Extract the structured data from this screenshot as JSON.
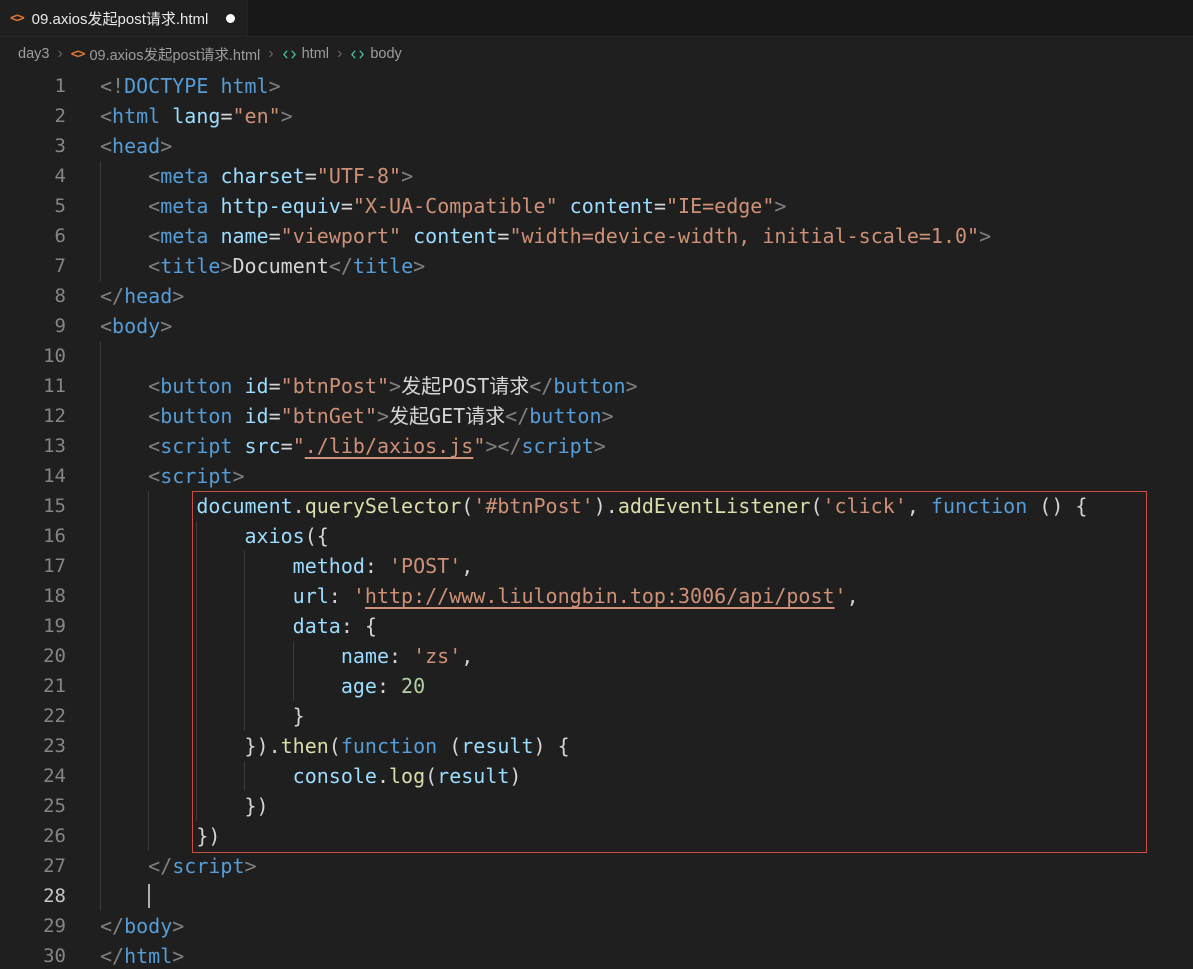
{
  "tab": {
    "title": "09.axios发起post请求.html",
    "modified": true
  },
  "breadcrumb": {
    "items": [
      "day3",
      "09.axios发起post请求.html",
      "html",
      "body"
    ]
  },
  "colors": {
    "annotation_border": "#c94f44",
    "modified_dot": "#ffffff",
    "file_icon": "#e37933",
    "element_icon": "#4ec9b0"
  },
  "editor": {
    "active_line": 28,
    "cursor_col": 4,
    "annotation": {
      "from_line": 15,
      "to_line": 26,
      "color": "#c94f44"
    },
    "lines": [
      {
        "tokens": [
          [
            "pg",
            "<!"
          ],
          [
            "tag",
            "DOCTYPE"
          ],
          [
            "pl",
            " "
          ],
          [
            "tag",
            "html"
          ],
          [
            "pg",
            ">"
          ]
        ]
      },
      {
        "tokens": [
          [
            "pg",
            "<"
          ],
          [
            "tag",
            "html"
          ],
          [
            "pl",
            " "
          ],
          [
            "attr",
            "lang"
          ],
          [
            "pl",
            "="
          ],
          [
            "str",
            "\"en\""
          ],
          [
            "pg",
            ">"
          ]
        ]
      },
      {
        "tokens": [
          [
            "pg",
            "<"
          ],
          [
            "tag",
            "head"
          ],
          [
            "pg",
            ">"
          ]
        ]
      },
      {
        "tokens": [
          [
            "pl",
            "    "
          ],
          [
            "pg",
            "<"
          ],
          [
            "tag",
            "meta"
          ],
          [
            "pl",
            " "
          ],
          [
            "attr",
            "charset"
          ],
          [
            "pl",
            "="
          ],
          [
            "str",
            "\"UTF-8\""
          ],
          [
            "pg",
            ">"
          ]
        ]
      },
      {
        "tokens": [
          [
            "pl",
            "    "
          ],
          [
            "pg",
            "<"
          ],
          [
            "tag",
            "meta"
          ],
          [
            "pl",
            " "
          ],
          [
            "attr",
            "http-equiv"
          ],
          [
            "pl",
            "="
          ],
          [
            "str",
            "\"X-UA-Compatible\""
          ],
          [
            "pl",
            " "
          ],
          [
            "attr",
            "content"
          ],
          [
            "pl",
            "="
          ],
          [
            "str",
            "\"IE=edge\""
          ],
          [
            "pg",
            ">"
          ]
        ]
      },
      {
        "tokens": [
          [
            "pl",
            "    "
          ],
          [
            "pg",
            "<"
          ],
          [
            "tag",
            "meta"
          ],
          [
            "pl",
            " "
          ],
          [
            "attr",
            "name"
          ],
          [
            "pl",
            "="
          ],
          [
            "str",
            "\"viewport\""
          ],
          [
            "pl",
            " "
          ],
          [
            "attr",
            "content"
          ],
          [
            "pl",
            "="
          ],
          [
            "str",
            "\"width=device-width, initial-scale=1.0\""
          ],
          [
            "pg",
            ">"
          ]
        ]
      },
      {
        "tokens": [
          [
            "pl",
            "    "
          ],
          [
            "pg",
            "<"
          ],
          [
            "tag",
            "title"
          ],
          [
            "pg",
            ">"
          ],
          [
            "pl",
            "Document"
          ],
          [
            "pg",
            "</"
          ],
          [
            "tag",
            "title"
          ],
          [
            "pg",
            ">"
          ]
        ]
      },
      {
        "tokens": [
          [
            "pg",
            "</"
          ],
          [
            "tag",
            "head"
          ],
          [
            "pg",
            ">"
          ]
        ]
      },
      {
        "tokens": [
          [
            "pg",
            "<"
          ],
          [
            "tag",
            "body"
          ],
          [
            "pg",
            ">"
          ]
        ]
      },
      {
        "tokens": [],
        "g": 1
      },
      {
        "tokens": [
          [
            "pl",
            "    "
          ],
          [
            "pg",
            "<"
          ],
          [
            "tag",
            "button"
          ],
          [
            "pl",
            " "
          ],
          [
            "attr",
            "id"
          ],
          [
            "pl",
            "="
          ],
          [
            "str",
            "\"btnPost\""
          ],
          [
            "pg",
            ">"
          ],
          [
            "pl",
            "发起POST请求"
          ],
          [
            "pg",
            "</"
          ],
          [
            "tag",
            "button"
          ],
          [
            "pg",
            ">"
          ]
        ]
      },
      {
        "tokens": [
          [
            "pl",
            "    "
          ],
          [
            "pg",
            "<"
          ],
          [
            "tag",
            "button"
          ],
          [
            "pl",
            " "
          ],
          [
            "attr",
            "id"
          ],
          [
            "pl",
            "="
          ],
          [
            "str",
            "\"btnGet\""
          ],
          [
            "pg",
            ">"
          ],
          [
            "pl",
            "发起GET请求"
          ],
          [
            "pg",
            "</"
          ],
          [
            "tag",
            "button"
          ],
          [
            "pg",
            ">"
          ]
        ]
      },
      {
        "tokens": [
          [
            "pl",
            "    "
          ],
          [
            "pg",
            "<"
          ],
          [
            "tag",
            "script"
          ],
          [
            "pl",
            " "
          ],
          [
            "attr",
            "src"
          ],
          [
            "pl",
            "="
          ],
          [
            "str",
            "\""
          ],
          [
            "lnk",
            "./lib/axios.js"
          ],
          [
            "str",
            "\""
          ],
          [
            "pg",
            ">"
          ],
          [
            "pg",
            "</"
          ],
          [
            "tag",
            "script"
          ],
          [
            "pg",
            ">"
          ]
        ]
      },
      {
        "tokens": [
          [
            "pl",
            "    "
          ],
          [
            "pg",
            "<"
          ],
          [
            "tag",
            "script"
          ],
          [
            "pg",
            ">"
          ]
        ]
      },
      {
        "tokens": [
          [
            "pl",
            "        "
          ],
          [
            "var",
            "document"
          ],
          [
            "pl",
            "."
          ],
          [
            "fn",
            "querySelector"
          ],
          [
            "pl",
            "("
          ],
          [
            "str",
            "'#btnPost'"
          ],
          [
            "pl",
            ")."
          ],
          [
            "fn",
            "addEventListener"
          ],
          [
            "pl",
            "("
          ],
          [
            "str",
            "'click'"
          ],
          [
            "pl",
            ", "
          ],
          [
            "kw",
            "function"
          ],
          [
            "pl",
            " () {"
          ]
        ]
      },
      {
        "tokens": [
          [
            "pl",
            "            "
          ],
          [
            "var",
            "axios"
          ],
          [
            "pl",
            "({"
          ]
        ]
      },
      {
        "tokens": [
          [
            "pl",
            "                "
          ],
          [
            "var",
            "method"
          ],
          [
            "pl",
            ": "
          ],
          [
            "str",
            "'POST'"
          ],
          [
            "pl",
            ","
          ]
        ]
      },
      {
        "tokens": [
          [
            "pl",
            "                "
          ],
          [
            "var",
            "url"
          ],
          [
            "pl",
            ": "
          ],
          [
            "str",
            "'"
          ],
          [
            "lnk",
            "http://www.liulongbin.top:3006/api/post"
          ],
          [
            "str",
            "'"
          ],
          [
            "pl",
            ","
          ]
        ]
      },
      {
        "tokens": [
          [
            "pl",
            "                "
          ],
          [
            "var",
            "data"
          ],
          [
            "pl",
            ": {"
          ]
        ]
      },
      {
        "tokens": [
          [
            "pl",
            "                    "
          ],
          [
            "var",
            "name"
          ],
          [
            "pl",
            ": "
          ],
          [
            "str",
            "'zs'"
          ],
          [
            "pl",
            ","
          ]
        ]
      },
      {
        "tokens": [
          [
            "pl",
            "                    "
          ],
          [
            "var",
            "age"
          ],
          [
            "pl",
            ": "
          ],
          [
            "num",
            "20"
          ]
        ]
      },
      {
        "tokens": [
          [
            "pl",
            "                }"
          ]
        ]
      },
      {
        "tokens": [
          [
            "pl",
            "            })."
          ],
          [
            "fn",
            "then"
          ],
          [
            "pl",
            "("
          ],
          [
            "kw",
            "function"
          ],
          [
            "pl",
            " ("
          ],
          [
            "var",
            "result"
          ],
          [
            "pl",
            ") {"
          ]
        ]
      },
      {
        "tokens": [
          [
            "pl",
            "                "
          ],
          [
            "var",
            "console"
          ],
          [
            "pl",
            "."
          ],
          [
            "fn",
            "log"
          ],
          [
            "pl",
            "("
          ],
          [
            "var",
            "result"
          ],
          [
            "pl",
            ")"
          ]
        ]
      },
      {
        "tokens": [
          [
            "pl",
            "            })"
          ]
        ]
      },
      {
        "tokens": [
          [
            "pl",
            "        })"
          ]
        ]
      },
      {
        "tokens": [
          [
            "pl",
            "    "
          ],
          [
            "pg",
            "</"
          ],
          [
            "tag",
            "script"
          ],
          [
            "pg",
            ">"
          ]
        ]
      },
      {
        "tokens": [],
        "g": 1
      },
      {
        "tokens": [
          [
            "pg",
            "</"
          ],
          [
            "tag",
            "body"
          ],
          [
            "pg",
            ">"
          ]
        ]
      },
      {
        "tokens": [
          [
            "pg",
            "</"
          ],
          [
            "tag",
            "html"
          ],
          [
            "pg",
            ">"
          ]
        ]
      }
    ]
  }
}
